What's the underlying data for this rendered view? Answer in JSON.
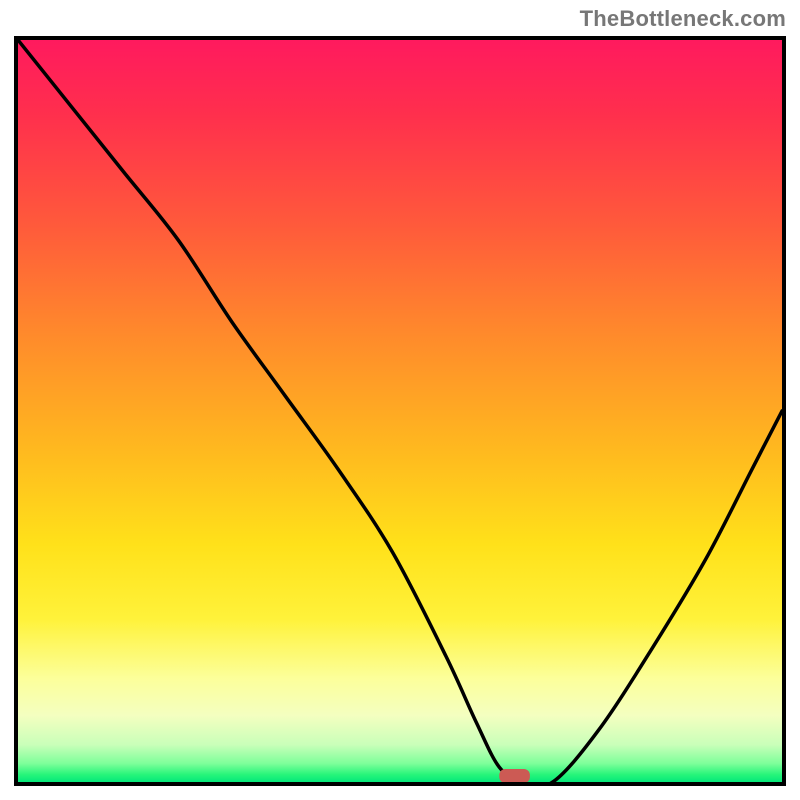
{
  "watermark": "TheBottleneck.com",
  "chart_data": {
    "type": "line",
    "title": "",
    "xlabel": "",
    "ylabel": "",
    "xlim": [
      0,
      100
    ],
    "ylim": [
      0,
      100
    ],
    "x": [
      0,
      7,
      14,
      21,
      28,
      35,
      42,
      49,
      56,
      60,
      63,
      66,
      70,
      76,
      83,
      90,
      96,
      100
    ],
    "values": [
      100,
      91,
      82,
      73,
      62,
      52,
      42,
      31,
      17,
      8,
      2,
      0,
      0,
      7,
      18,
      30,
      42,
      50
    ],
    "background_gradient": {
      "orientation": "vertical_top_to_bottom",
      "stops": [
        {
          "pos": 0.0,
          "color": "#ff1a5e"
        },
        {
          "pos": 0.25,
          "color": "#ff5a3b"
        },
        {
          "pos": 0.55,
          "color": "#ffb81f"
        },
        {
          "pos": 0.78,
          "color": "#fff23a"
        },
        {
          "pos": 0.91,
          "color": "#f4ffc0"
        },
        {
          "pos": 1.0,
          "color": "#05e87a"
        }
      ]
    },
    "marker": {
      "x_center": 65,
      "y": 0,
      "width_pct": 4,
      "color": "#cc5a54"
    },
    "series": [
      {
        "name": "bottleneck-curve",
        "x": [
          0,
          7,
          14,
          21,
          28,
          35,
          42,
          49,
          56,
          60,
          63,
          66,
          70,
          76,
          83,
          90,
          96,
          100
        ],
        "values": [
          100,
          91,
          82,
          73,
          62,
          52,
          42,
          31,
          17,
          8,
          2,
          0,
          0,
          7,
          18,
          30,
          42,
          50
        ]
      }
    ]
  }
}
